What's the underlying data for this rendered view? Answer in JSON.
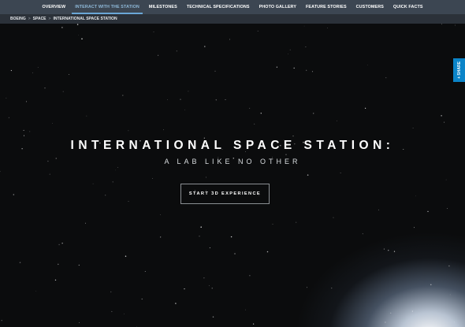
{
  "nav": {
    "items": [
      {
        "label": "OVERVIEW",
        "active": false
      },
      {
        "label": "INTERACT WITH THE STATION",
        "active": true
      },
      {
        "label": "MILESTONES",
        "active": false
      },
      {
        "label": "TECHNICAL SPECIFICATIONS",
        "active": false
      },
      {
        "label": "PHOTO GALLERY",
        "active": false
      },
      {
        "label": "FEATURE STORIES",
        "active": false
      },
      {
        "label": "CUSTOMERS",
        "active": false
      },
      {
        "label": "QUICK FACTS",
        "active": false
      }
    ]
  },
  "breadcrumb": {
    "items": [
      "BOEING",
      "SPACE",
      "INTERNATIONAL SPACE STATION"
    ],
    "separator": ">"
  },
  "hero": {
    "title": "INTERNATIONAL SPACE STATION:",
    "subtitle": "A LAB LIKE NO OTHER",
    "cta_label": "START 3D EXPERIENCE"
  },
  "share": {
    "label": "+ SHARE",
    "color": "#0b84c8"
  },
  "colors": {
    "nav_bg": "#3c4652",
    "breadcrumb_bg": "#2b3139",
    "hero_bg": "#0b0c0d",
    "active_nav": "#8fb9d9"
  }
}
